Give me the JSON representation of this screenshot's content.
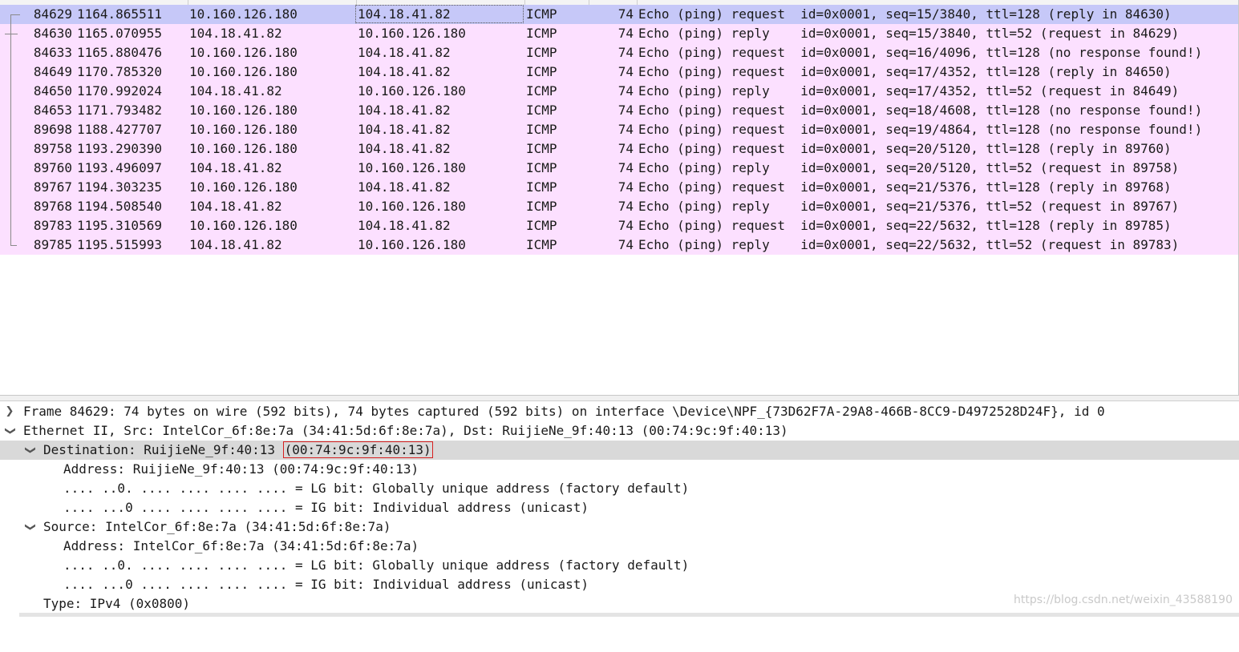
{
  "packet_list": {
    "rows": [
      {
        "no": "84629",
        "time": "1164.865511",
        "src": "10.160.126.180",
        "dst": "104.18.41.82",
        "proto": "ICMP",
        "len": "74",
        "info": "Echo (ping) request  id=0x0001, seq=15/3840, ttl=128 (reply in 84630)"
      },
      {
        "no": "84630",
        "time": "1165.070955",
        "src": "104.18.41.82",
        "dst": "10.160.126.180",
        "proto": "ICMP",
        "len": "74",
        "info": "Echo (ping) reply    id=0x0001, seq=15/3840, ttl=52 (request in 84629)"
      },
      {
        "no": "84633",
        "time": "1165.880476",
        "src": "10.160.126.180",
        "dst": "104.18.41.82",
        "proto": "ICMP",
        "len": "74",
        "info": "Echo (ping) request  id=0x0001, seq=16/4096, ttl=128 (no response found!)"
      },
      {
        "no": "84649",
        "time": "1170.785320",
        "src": "10.160.126.180",
        "dst": "104.18.41.82",
        "proto": "ICMP",
        "len": "74",
        "info": "Echo (ping) request  id=0x0001, seq=17/4352, ttl=128 (reply in 84650)"
      },
      {
        "no": "84650",
        "time": "1170.992024",
        "src": "104.18.41.82",
        "dst": "10.160.126.180",
        "proto": "ICMP",
        "len": "74",
        "info": "Echo (ping) reply    id=0x0001, seq=17/4352, ttl=52 (request in 84649)"
      },
      {
        "no": "84653",
        "time": "1171.793482",
        "src": "10.160.126.180",
        "dst": "104.18.41.82",
        "proto": "ICMP",
        "len": "74",
        "info": "Echo (ping) request  id=0x0001, seq=18/4608, ttl=128 (no response found!)"
      },
      {
        "no": "89698",
        "time": "1188.427707",
        "src": "10.160.126.180",
        "dst": "104.18.41.82",
        "proto": "ICMP",
        "len": "74",
        "info": "Echo (ping) request  id=0x0001, seq=19/4864, ttl=128 (no response found!)"
      },
      {
        "no": "89758",
        "time": "1193.290390",
        "src": "10.160.126.180",
        "dst": "104.18.41.82",
        "proto": "ICMP",
        "len": "74",
        "info": "Echo (ping) request  id=0x0001, seq=20/5120, ttl=128 (reply in 89760)"
      },
      {
        "no": "89760",
        "time": "1193.496097",
        "src": "104.18.41.82",
        "dst": "10.160.126.180",
        "proto": "ICMP",
        "len": "74",
        "info": "Echo (ping) reply    id=0x0001, seq=20/5120, ttl=52 (request in 89758)"
      },
      {
        "no": "89767",
        "time": "1194.303235",
        "src": "10.160.126.180",
        "dst": "104.18.41.82",
        "proto": "ICMP",
        "len": "74",
        "info": "Echo (ping) request  id=0x0001, seq=21/5376, ttl=128 (reply in 89768)"
      },
      {
        "no": "89768",
        "time": "1194.508540",
        "src": "104.18.41.82",
        "dst": "10.160.126.180",
        "proto": "ICMP",
        "len": "74",
        "info": "Echo (ping) reply    id=0x0001, seq=21/5376, ttl=52 (request in 89767)"
      },
      {
        "no": "89783",
        "time": "1195.310569",
        "src": "10.160.126.180",
        "dst": "104.18.41.82",
        "proto": "ICMP",
        "len": "74",
        "info": "Echo (ping) request  id=0x0001, seq=22/5632, ttl=128 (reply in 89785)"
      },
      {
        "no": "89785",
        "time": "1195.515993",
        "src": "104.18.41.82",
        "dst": "10.160.126.180",
        "proto": "ICMP",
        "len": "74",
        "info": "Echo (ping) reply    id=0x0001, seq=22/5632, ttl=52 (request in 89783)"
      }
    ]
  },
  "details": {
    "frame": "Frame 84629: 74 bytes on wire (592 bits), 74 bytes captured (592 bits) on interface \\Device\\NPF_{73D62F7A-29A8-466B-8CC9-D4972528D24F}, id 0",
    "ethernet": "Ethernet II, Src: IntelCor_6f:8e:7a (34:41:5d:6f:8e:7a), Dst: RuijieNe_9f:40:13 (00:74:9c:9f:40:13)",
    "destination": "Destination: RuijieNe_9f:40:13 ",
    "destination_addr": "(00:74:9c:9f:40:13)",
    "dst_address": "Address: RuijieNe_9f:40:13 (00:74:9c:9f:40:13)",
    "dst_lg": ".... ..0. .... .... .... .... = LG bit: Globally unique address (factory default)",
    "dst_ig": ".... ...0 .... .... .... .... = IG bit: Individual address (unicast)",
    "source": "Source: IntelCor_6f:8e:7a (34:41:5d:6f:8e:7a)",
    "src_address": "Address: IntelCor_6f:8e:7a (34:41:5d:6f:8e:7a)",
    "src_lg": ".... ..0. .... .... .... .... = LG bit: Globally unique address (factory default)",
    "src_ig": ".... ...0 .... .... .... .... = IG bit: Individual address (unicast)",
    "type": "Type: IPv4 (0x0800)"
  },
  "watermark": "https://blog.csdn.net/weixin_43588190",
  "icons": {
    "collapsed": "chevron-right-icon",
    "expanded": "chevron-down-icon"
  },
  "colors": {
    "row_bg": "#fce0ff",
    "selected_bg": "#c6c8f8",
    "highlight_bg": "#d9d9d9",
    "box_border": "#d62020"
  }
}
